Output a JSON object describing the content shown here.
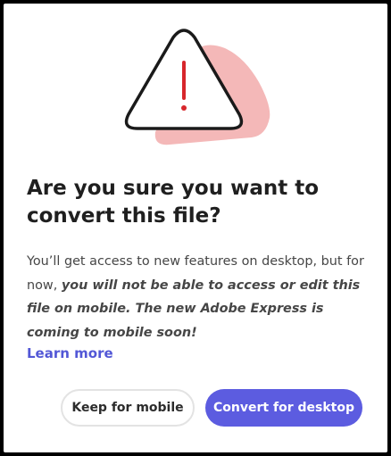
{
  "dialog": {
    "heading": "Are you sure you want to convert this file?",
    "body_regular": "You’ll get access to new features on desktop, but for now, ",
    "body_emphasis": "you will not be able to access or edit this file on mobile. The new Adobe Express is coming to mobile soon!",
    "learn_more": "Learn more",
    "keep_button": "Keep for mobile",
    "convert_button": "Convert for desktop"
  },
  "illustration": {
    "icon": "warning-triangle-icon",
    "accent_color": "#f4b8b8",
    "exclamation_color": "#d7262b"
  },
  "colors": {
    "primary": "#5c5ce0",
    "link": "#5257d6"
  }
}
